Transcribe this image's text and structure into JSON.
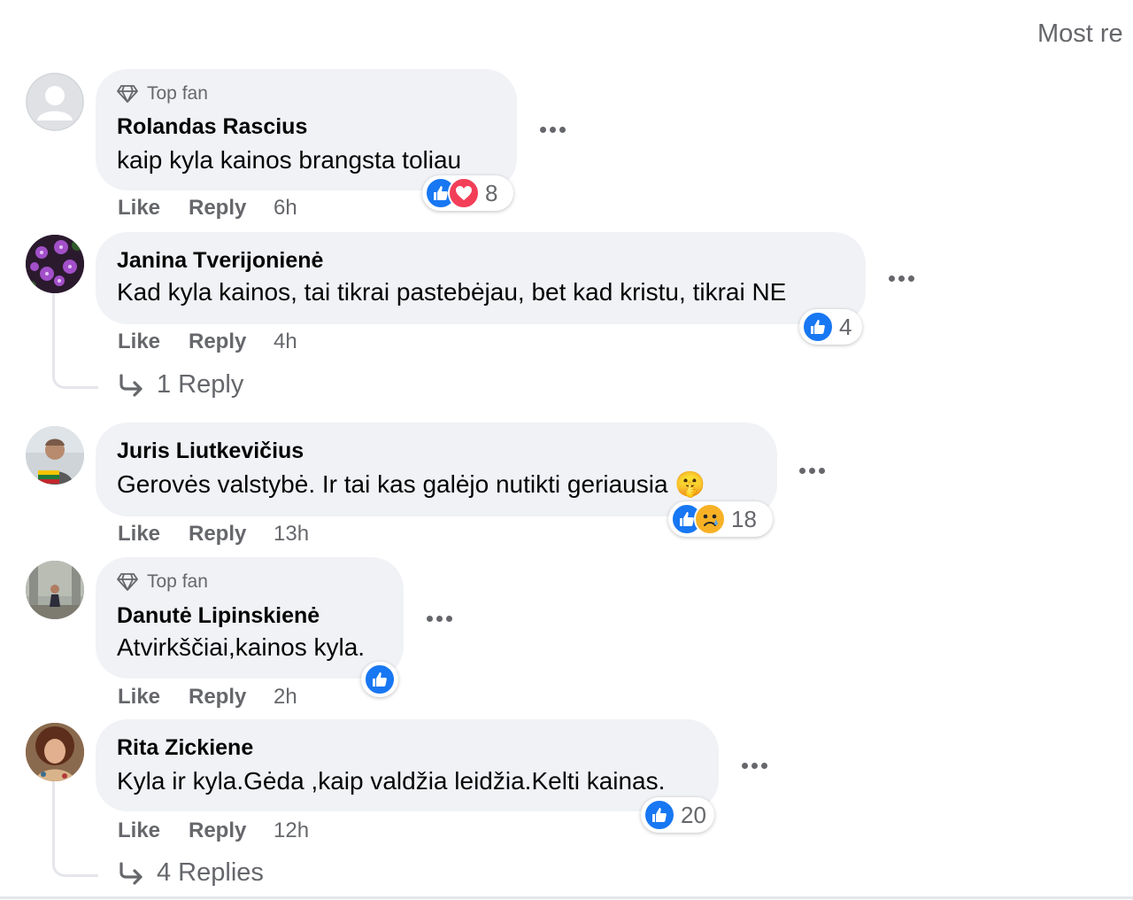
{
  "sort": {
    "label": "Most re"
  },
  "comments": [
    {
      "badge": "Top fan",
      "author": "Rolandas Rascius",
      "text": "kaip kyla kainos brangsta toliau",
      "like": "Like",
      "reply": "Reply",
      "time": "6h",
      "reactions": [
        "like",
        "love"
      ],
      "reaction_count": "8"
    },
    {
      "author": "Janina Tverijonienė",
      "text": "Kad kyla kainos, tai tikrai pastebėjau, bet kad kristu, tikrai NE",
      "like": "Like",
      "reply": "Reply",
      "time": "4h",
      "reactions": [
        "like"
      ],
      "reaction_count": "4",
      "replies": "1 Reply"
    },
    {
      "author": "Juris Liutkevičius",
      "text": "Gerovės valstybė. Ir tai kas galėjo nutikti geriausia 🤫",
      "like": "Like",
      "reply": "Reply",
      "time": "13h",
      "reactions": [
        "like",
        "sad"
      ],
      "reaction_count": "18"
    },
    {
      "badge": "Top fan",
      "author": "Danutė Lipinskienė",
      "text": "Atvirkščiai,kainos kyla.",
      "like": "Like",
      "reply": "Reply",
      "time": "2h",
      "reactions": [
        "like"
      ],
      "reaction_count": ""
    },
    {
      "author": "Rita Zickiene",
      "text": "Kyla ir kyla.Gėda ,kaip valdžia leidžia.Kelti kainas.",
      "like": "Like",
      "reply": "Reply",
      "time": "12h",
      "reactions": [
        "like"
      ],
      "reaction_count": "20",
      "replies": "4 Replies"
    }
  ],
  "colors": {
    "bubble": "#f0f2f5",
    "secondary_text": "#65676b",
    "like_blue": "#1877f2",
    "love_red": "#f33e58",
    "sad_yellow": "#f7b125"
  },
  "icons": {
    "badge": "diamond-icon",
    "more": "more-options-icon",
    "replies": "reply-arrow-icon",
    "reactions": [
      "thumbs-up-icon",
      "heart-icon",
      "sad-face-icon"
    ]
  }
}
